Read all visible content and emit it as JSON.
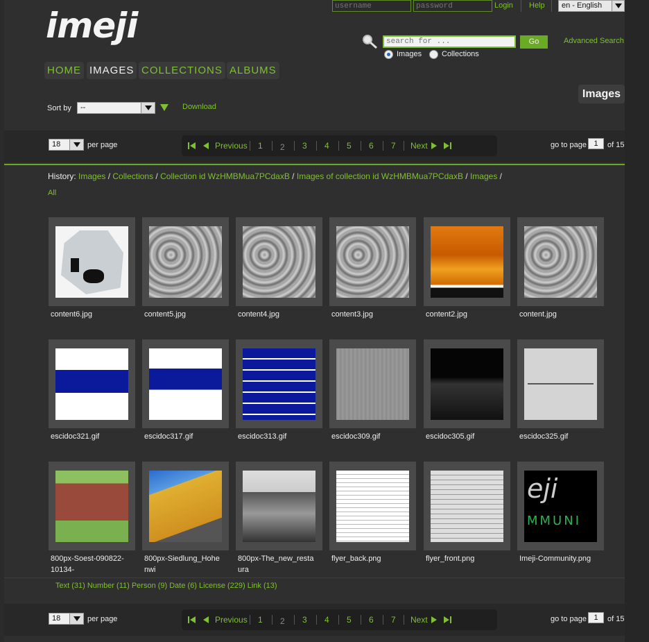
{
  "header": {
    "username_placeholder": "username",
    "password_placeholder": "password",
    "login": "Login",
    "help": "Help",
    "language": "en - English",
    "logo": "imeji",
    "search_placeholder": "search for ...",
    "go": "Go",
    "advanced_search": "Advanced Search",
    "search_scope": [
      "Images",
      "Collections"
    ]
  },
  "nav": [
    "HOME",
    "IMAGES",
    "COLLECTIONS",
    "ALBUMS"
  ],
  "page_title": "Images",
  "sort": {
    "label": "Sort by",
    "value": "--",
    "download": "Download"
  },
  "pagination": {
    "per_page_value": "18",
    "per_page_label": "per page",
    "previous": "Previous",
    "pages": [
      "1",
      "2",
      "3",
      "4",
      "5",
      "6",
      "7"
    ],
    "current": "2",
    "next": "Next",
    "goto_label": "go to page",
    "goto_value": "1",
    "of": "of 15"
  },
  "history": {
    "label": "History:",
    "crumbs": [
      "Images",
      "Collections",
      "Collection id WzHMBMua7PCdaxB",
      "Images of collection id WzHMBMua7PCdaxB",
      "Images",
      "All"
    ]
  },
  "images": [
    {
      "name": "content6.jpg",
      "kind": "wafer"
    },
    {
      "name": "content5.jpg",
      "kind": "sem"
    },
    {
      "name": "content4.jpg",
      "kind": "sem"
    },
    {
      "name": "content3.jpg",
      "kind": "sem"
    },
    {
      "name": "content2.jpg",
      "kind": "afm"
    },
    {
      "name": "content.jpg",
      "kind": "sem"
    },
    {
      "name": "escidoc321.gif",
      "kind": "plot-blue"
    },
    {
      "name": "escidoc317.gif",
      "kind": "plot-blue2"
    },
    {
      "name": "escidoc313.gif",
      "kind": "plot-stripes"
    },
    {
      "name": "escidoc309.gif",
      "kind": "grey"
    },
    {
      "name": "escidoc305.gif",
      "kind": "dark"
    },
    {
      "name": "escidoc325.gif",
      "kind": "needle"
    },
    {
      "name": "800px-Soest-090822-10134-",
      "kind": "building"
    },
    {
      "name": "800px-Siedlung_Hohenwi",
      "kind": "yellow-building"
    },
    {
      "name": "800px-The_new_restaura",
      "kind": "bw-photo"
    },
    {
      "name": "flyer_back.png",
      "kind": "doc"
    },
    {
      "name": "flyer_front.png",
      "kind": "doc2"
    },
    {
      "name": "Imeji-Community.png",
      "kind": "community"
    }
  ],
  "facets": "Text (31) Number (11) Person (9) Date (6) License (229) Link (13)",
  "colors": {
    "accent": "#7ec031",
    "background": "#2f2f2f",
    "tile": "#4a4a4a"
  }
}
